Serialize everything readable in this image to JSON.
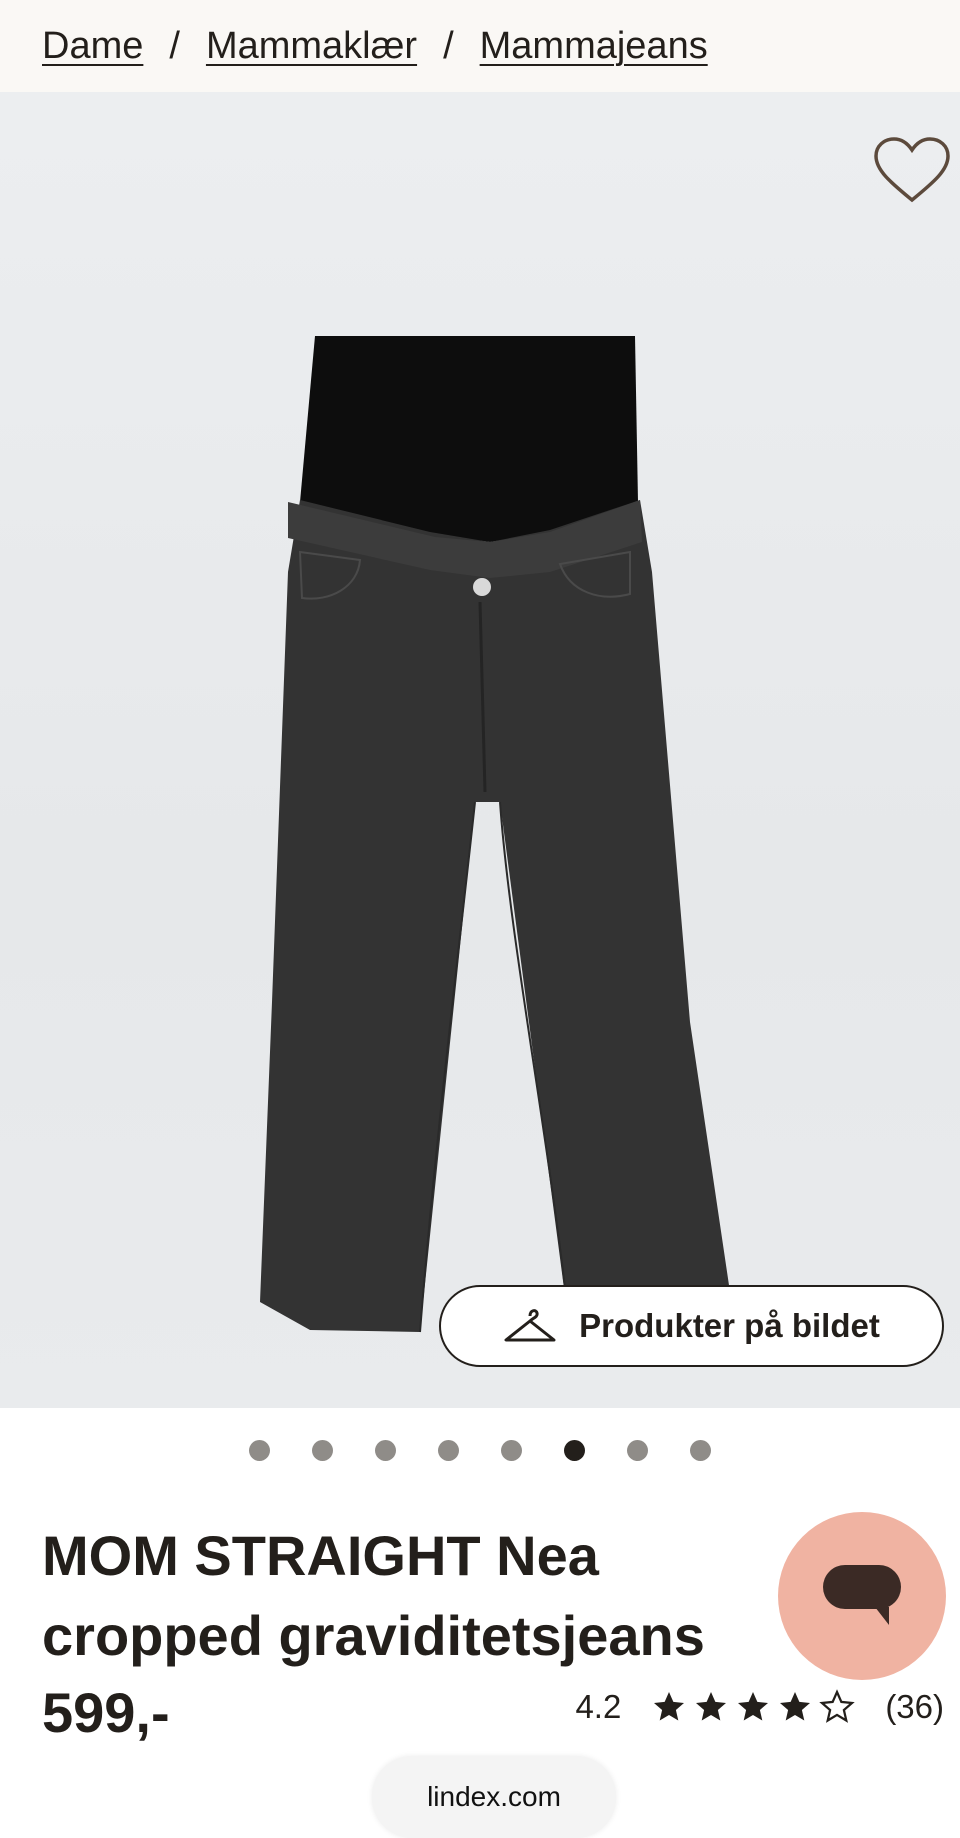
{
  "breadcrumb": {
    "items": [
      "Dame",
      "Mammaklær",
      "Mammajeans"
    ],
    "separator": "/"
  },
  "hero": {
    "wishlist_icon": "heart-outline-icon",
    "products_button_icon": "hanger-icon",
    "products_button_label": "Produkter på bildet",
    "carousel_count": 8,
    "carousel_active_index": 5
  },
  "product": {
    "title": "MOM STRAIGHT Nea cropped graviditetsjeans",
    "price": "599,-",
    "rating_value": "4.2",
    "rating_stars": 4,
    "rating_max": 5,
    "review_count": "(36)"
  },
  "chat": {
    "icon": "chat-bubble-icon",
    "color": "#f0b3a2"
  },
  "browser": {
    "url": "lindex.com"
  },
  "colors": {
    "text": "#231f1b",
    "breadcrumb_bg": "#faf8f5",
    "dot_inactive": "#8f8c88"
  }
}
